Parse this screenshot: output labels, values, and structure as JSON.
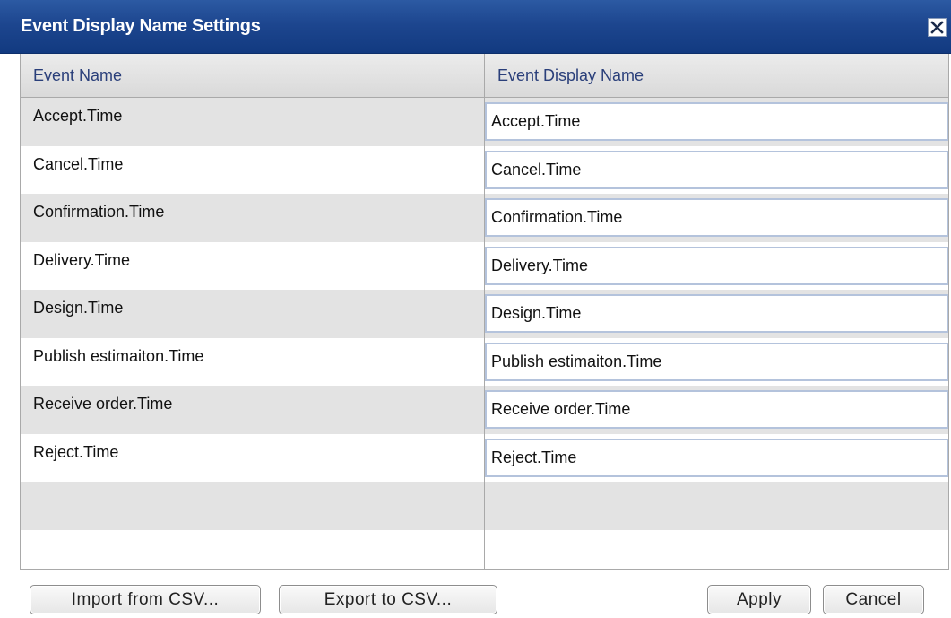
{
  "dialog": {
    "title": "Event Display Name Settings"
  },
  "table": {
    "headers": [
      "Event Name",
      "Event Display Name"
    ],
    "rows": [
      {
        "name": "Accept.Time",
        "display_name": "Accept.Time"
      },
      {
        "name": "Cancel.Time",
        "display_name": "Cancel.Time"
      },
      {
        "name": "Confirmation.Time",
        "display_name": "Confirmation.Time"
      },
      {
        "name": "Delivery.Time",
        "display_name": "Delivery.Time"
      },
      {
        "name": "Design.Time",
        "display_name": "Design.Time"
      },
      {
        "name": "Publish estimaiton.Time",
        "display_name": "Publish estimaiton.Time"
      },
      {
        "name": "Receive order.Time",
        "display_name": "Receive order.Time"
      },
      {
        "name": "Reject.Time",
        "display_name": "Reject.Time"
      }
    ]
  },
  "buttons": {
    "import": "Import from CSV...",
    "export": "Export to CSV...",
    "apply": "Apply",
    "cancel": "Cancel"
  },
  "colors": {
    "titlebar": "#1d468f",
    "header_text": "#2a3f7a",
    "row_alt": "#e3e3e3",
    "input_border": "#b4c3dc"
  },
  "icons": {
    "close": "close-icon"
  }
}
